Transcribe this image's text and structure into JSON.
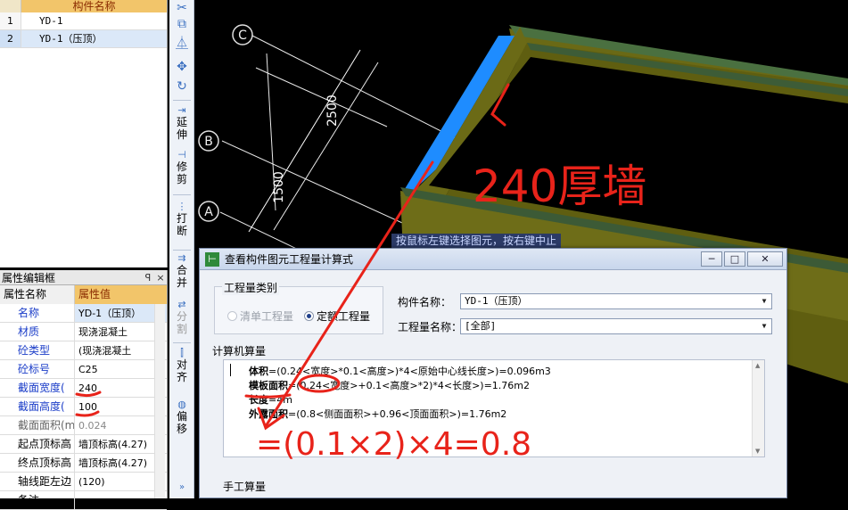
{
  "component_list": {
    "header": "构件名称",
    "rows": [
      {
        "num": "1",
        "name": "YD-1"
      },
      {
        "num": "2",
        "name": "YD-1（压顶）"
      }
    ]
  },
  "property_panel": {
    "title": "属性编辑框",
    "pin": "ꟼ",
    "close": "×",
    "col_name": "属性名称",
    "col_value": "属性值",
    "rows": [
      {
        "name": "名称",
        "value": "YD-1（压顶）"
      },
      {
        "name": "材质",
        "value": "现浇混凝土"
      },
      {
        "name": "砼类型",
        "value": "(现浇混凝土"
      },
      {
        "name": "砼标号",
        "value": "C25"
      },
      {
        "name": "截面宽度(",
        "value": "240"
      },
      {
        "name": "截面高度(",
        "value": "100"
      },
      {
        "name": "截面面积(m",
        "value": "0.024"
      },
      {
        "name": "起点顶标高",
        "value": "墙顶标高(4.27)"
      },
      {
        "name": "终点顶标高",
        "value": "墙顶标高(4.27)"
      },
      {
        "name": "轴线距左边",
        "value": "(120)"
      },
      {
        "name": "备注",
        "value": ""
      }
    ]
  },
  "toolbar": {
    "extend": "延伸",
    "trim": "修剪",
    "break": "打断",
    "merge": "合并",
    "split": "分割",
    "align": "对齐",
    "offset": "偏移"
  },
  "viewport": {
    "axis_labels": [
      "C",
      "B",
      "A"
    ],
    "dim_2500": "2500",
    "dim_1500": "1500",
    "tooltip": "按鼠标左键选择图元，按右键中止"
  },
  "dialog": {
    "title": "查看构件图元工程量计算式",
    "minimize": "─",
    "maximize": "□",
    "close": "✕",
    "type_group": "工程量类别",
    "radio_list": "清单工程量",
    "radio_quota": "定额工程量",
    "component_name_label": "构件名称：",
    "component_name_value": "YD-1（压顶）",
    "quantity_name_label": "工程量名称：",
    "quantity_name_value": "[全部]",
    "calc_label": "计算机算量",
    "calc_lines": [
      {
        "bold": "体积",
        "rest": "=(0.24<宽度>*0.1<高度>)*4<原始中心线长度>)=0.096m3"
      },
      {
        "bold": "模板面积",
        "rest": "=(0.24<宽度>+0.1<高度>*2)*4<长度>)=1.76m2"
      },
      {
        "bold": "长度",
        "rest": "=4m"
      },
      {
        "bold": "外露面积",
        "rest": "=(0.8<侧面面积>+0.96<顶面面积>)=1.76m2"
      }
    ],
    "manual_label": "手工算量"
  },
  "annotations": {
    "wall_note": "240厚墙",
    "formula_note": "=(0.1×2)×4=0.8"
  },
  "colors": {
    "annotation": "#e8231a",
    "wall_top_blue": "#1e8cff",
    "wall_olive": "#6b6a16",
    "wall_green_top": "#3c5a36",
    "header_orange": "#f2c56a"
  }
}
